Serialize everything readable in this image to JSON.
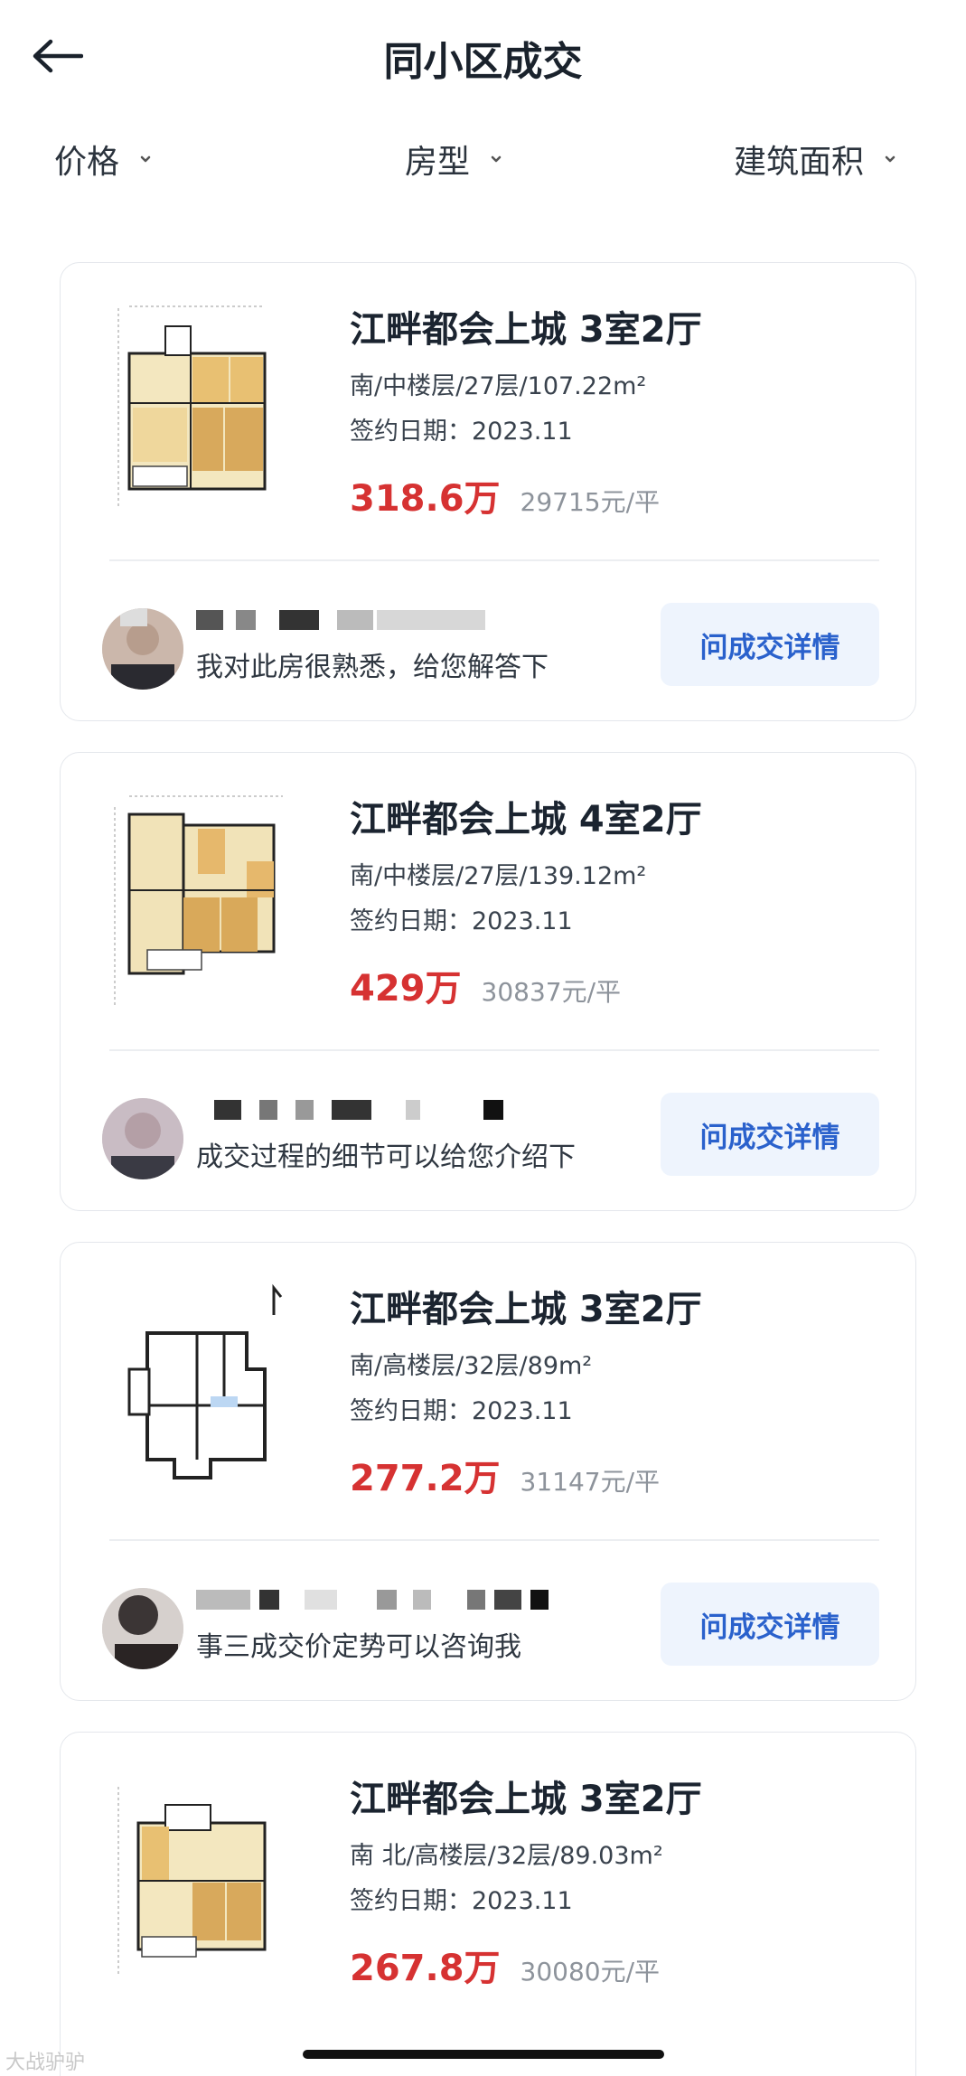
{
  "header": {
    "title": "同小区成交"
  },
  "filters": [
    {
      "label": "价格"
    },
    {
      "label": "房型"
    },
    {
      "label": "建筑面积"
    }
  ],
  "listings": [
    {
      "title": "江畔都会上城 3室2厅",
      "spec": "南/中楼层/27层/107.22m²",
      "date": "签约日期：2023.11",
      "price": "318.6万",
      "unit_price": "29715元/平",
      "agent_message": "我对此房很熟悉，给您解答下",
      "button": "问成交详情"
    },
    {
      "title": "江畔都会上城 4室2厅",
      "spec": "南/中楼层/27层/139.12m²",
      "date": "签约日期：2023.11",
      "price": "429万",
      "unit_price": "30837元/平",
      "agent_message": "成交过程的细节可以给您介绍下",
      "button": "问成交详情"
    },
    {
      "title": "江畔都会上城 3室2厅",
      "spec": "南/高楼层/32层/89m²",
      "date": "签约日期：2023.11",
      "price": "277.2万",
      "unit_price": "31147元/平",
      "agent_message": "事三成交价定势可以咨询我",
      "button": "问成交详情"
    },
    {
      "title": "江畔都会上城 3室2厅",
      "spec": "南 北/高楼层/32层/89.03m²",
      "date": "签约日期：2023.11",
      "price": "267.8万",
      "unit_price": "30080元/平"
    }
  ],
  "watermark": "大战驴驴",
  "colors": {
    "price": "#d63232",
    "button_text": "#2a61cc",
    "button_bg": "#eef4fd",
    "card_border": "#e4e7ec"
  }
}
